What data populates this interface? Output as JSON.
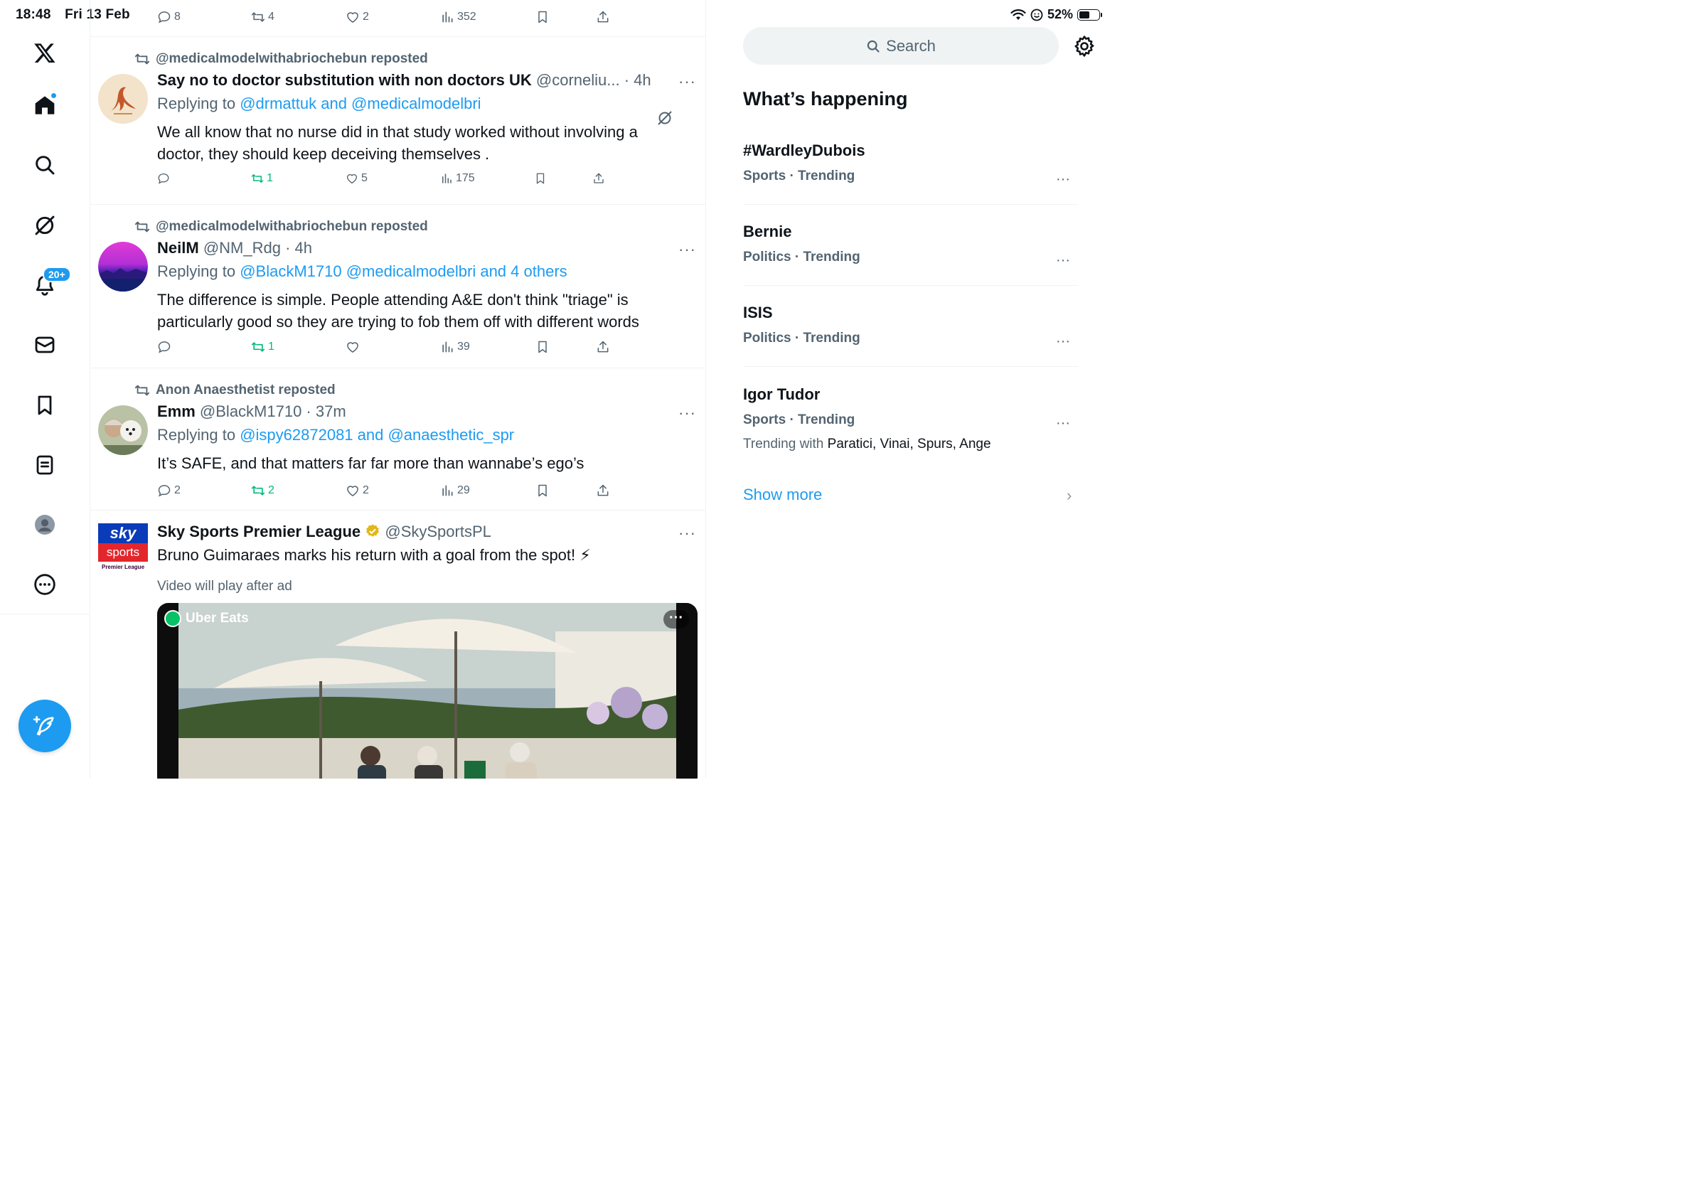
{
  "status": {
    "time": "18:48",
    "date": "Fri 13 Feb",
    "battery": "52%",
    "battery_level": 0.52
  },
  "nav": {
    "notifications_badge": "20+"
  },
  "timeline": {
    "top_partial": {
      "replies": "8",
      "reposts": "4",
      "likes": "2",
      "views": "352"
    },
    "posts": [
      {
        "repost_by": "@medicalmodelwithabriochebun reposted",
        "name": "Say no to doctor substitution with non doctors UK",
        "handle": "@corneliu... · 4h",
        "replying_label": "Replying to",
        "mentions": "@drmattuk and @medicalmodelbri",
        "text": "We all know that no nurse did in that study worked without involving a doctor, they should keep deceiving themselves .",
        "replies": "",
        "reposts": "1",
        "likes": "5",
        "views": "175"
      },
      {
        "repost_by": "@medicalmodelwithabriochebun reposted",
        "name": "NeilM",
        "handle": "@NM_Rdg · 4h",
        "replying_label": "Replying to",
        "mentions": "@BlackM1710 @medicalmodelbri and 4 others",
        "text": "The difference is simple. People attending A&E don't think \"triage\" is particularly good so they are trying to fob them off with different words",
        "replies": "",
        "reposts": "1",
        "likes": "",
        "views": "39"
      },
      {
        "repost_by": "Anon Anaesthetist reposted",
        "name": "Emm",
        "handle": "@BlackM1710 · 37m",
        "replying_label": "Replying to",
        "mentions": "@ispy62872081 and @anaesthetic_spr",
        "text": "It’s SAFE, and that matters far far more than wannabe’s ego’s",
        "replies": "2",
        "reposts": "2",
        "likes": "2",
        "views": "29"
      },
      {
        "name": "Sky Sports Premier League",
        "handle": "@SkySportsPL",
        "text": "Bruno Guimaraes marks his return with a goal from the spot! ⚡",
        "video_note": "Video will play after ad",
        "ad_brand": "Uber Eats",
        "avatar_top": "sky",
        "avatar_mid": "sports",
        "avatar_bottom": "Premier League"
      }
    ]
  },
  "sidebar": {
    "search_placeholder": "Search",
    "section_title": "What’s happening",
    "trends": [
      {
        "name": "#WardleyDubois",
        "meta": "Sports · Trending"
      },
      {
        "name": "Bernie",
        "meta": "Politics · Trending"
      },
      {
        "name": "ISIS",
        "meta": "Politics · Trending"
      },
      {
        "name": "Igor Tudor",
        "meta": "Sports · Trending",
        "with_label": "Trending with",
        "with_names": "Paratici, Vinai, Spurs, Ange"
      }
    ],
    "show_more": "Show more"
  },
  "colors": {
    "accent": "#1d9bf0",
    "repost_green": "#00ba7c",
    "muted": "#536471",
    "text": "#0f1419"
  }
}
